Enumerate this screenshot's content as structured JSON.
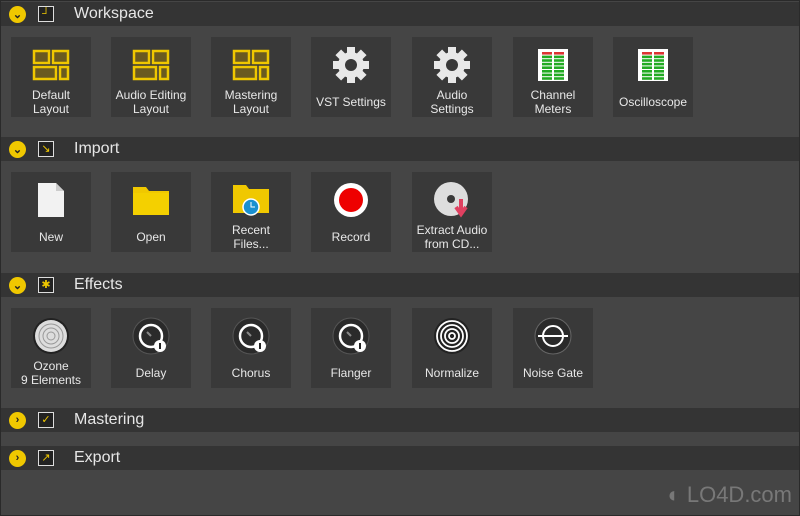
{
  "sections": [
    {
      "title": "Workspace",
      "icon": "layout-add-icon",
      "expanded": true,
      "items": [
        {
          "label": "Default\nLayout",
          "icon": "layout-icon"
        },
        {
          "label": "Audio Editing\nLayout",
          "icon": "layout-icon"
        },
        {
          "label": "Mastering\nLayout",
          "icon": "layout-icon"
        },
        {
          "label": "VST Settings",
          "icon": "gear-icon"
        },
        {
          "label": "Audio\nSettings",
          "icon": "gear-icon"
        },
        {
          "label": "Channel\nMeters",
          "icon": "meter-icon"
        },
        {
          "label": "Oscilloscope",
          "icon": "meter-icon"
        }
      ]
    },
    {
      "title": "Import",
      "icon": "import-arrow-icon",
      "expanded": true,
      "items": [
        {
          "label": "New",
          "icon": "file-icon"
        },
        {
          "label": "Open",
          "icon": "folder-icon"
        },
        {
          "label": "Recent\nFiles...",
          "icon": "recent-folder-icon"
        },
        {
          "label": "Record",
          "icon": "record-icon"
        },
        {
          "label": "Extract Audio\nfrom CD...",
          "icon": "cd-icon"
        }
      ]
    },
    {
      "title": "Effects",
      "icon": "star-icon",
      "expanded": true,
      "items": [
        {
          "label": "Ozone\n9 Elements",
          "icon": "ozone-icon"
        },
        {
          "label": "Delay",
          "icon": "knob-icon"
        },
        {
          "label": "Chorus",
          "icon": "knob-icon"
        },
        {
          "label": "Flanger",
          "icon": "knob-icon"
        },
        {
          "label": "Normalize",
          "icon": "normalize-icon"
        },
        {
          "label": "Noise Gate",
          "icon": "noise-gate-icon"
        }
      ]
    },
    {
      "title": "Mastering",
      "icon": "checkbox-icon",
      "expanded": false,
      "items": []
    },
    {
      "title": "Export",
      "icon": "export-arrow-icon",
      "expanded": false,
      "items": []
    }
  ],
  "watermark": "LO4D.com",
  "colors": {
    "accent": "#f0c800",
    "header": "#343434",
    "tile": "#393939",
    "background": "#454545"
  }
}
